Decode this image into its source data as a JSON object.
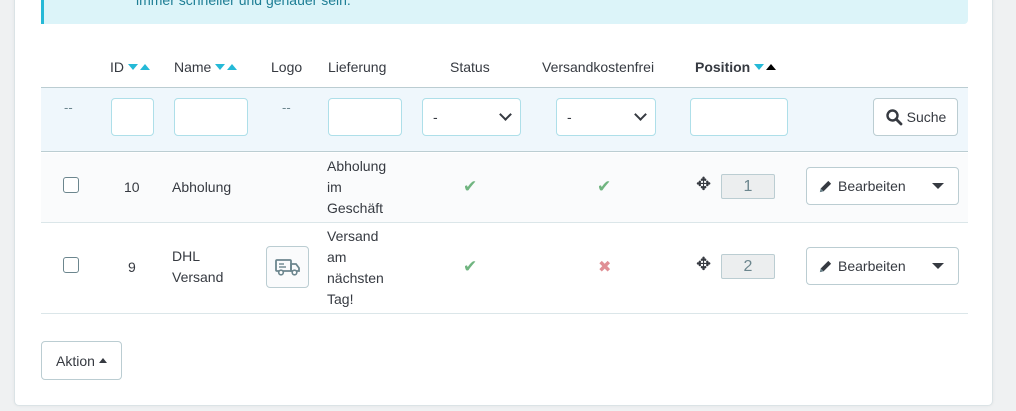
{
  "alert": {
    "text": "immer schneller und genauer sein."
  },
  "columns": {
    "id": "ID",
    "name": "Name",
    "logo": "Logo",
    "delivery": "Lieferung",
    "status": "Status",
    "free_shipping": "Versandkostenfrei",
    "position": "Position"
  },
  "filters": {
    "dash_checkbox": "--",
    "dash_logo": "--",
    "status_value": "-",
    "free_shipping_value": "-",
    "search_label": "Suche"
  },
  "rows": [
    {
      "id": "10",
      "name": "Abholung",
      "delivery_lines": [
        "Abholung",
        "im",
        "Geschäft"
      ],
      "status": "enabled",
      "free_shipping": "enabled",
      "position": "1",
      "edit_label": "Bearbeiten"
    },
    {
      "id": "9",
      "name_lines": [
        "DHL",
        "Versand"
      ],
      "delivery_lines": [
        "Versand",
        "am",
        "nächsten",
        "Tag!"
      ],
      "status": "enabled",
      "free_shipping": "disabled",
      "position": "2",
      "edit_label": "Bearbeiten",
      "logo_icon": "truck-icon"
    }
  ],
  "bulk_action_label": "Aktion",
  "colors": {
    "accent": "#25b9d7",
    "success": "#70b580",
    "danger": "#e08f95"
  }
}
